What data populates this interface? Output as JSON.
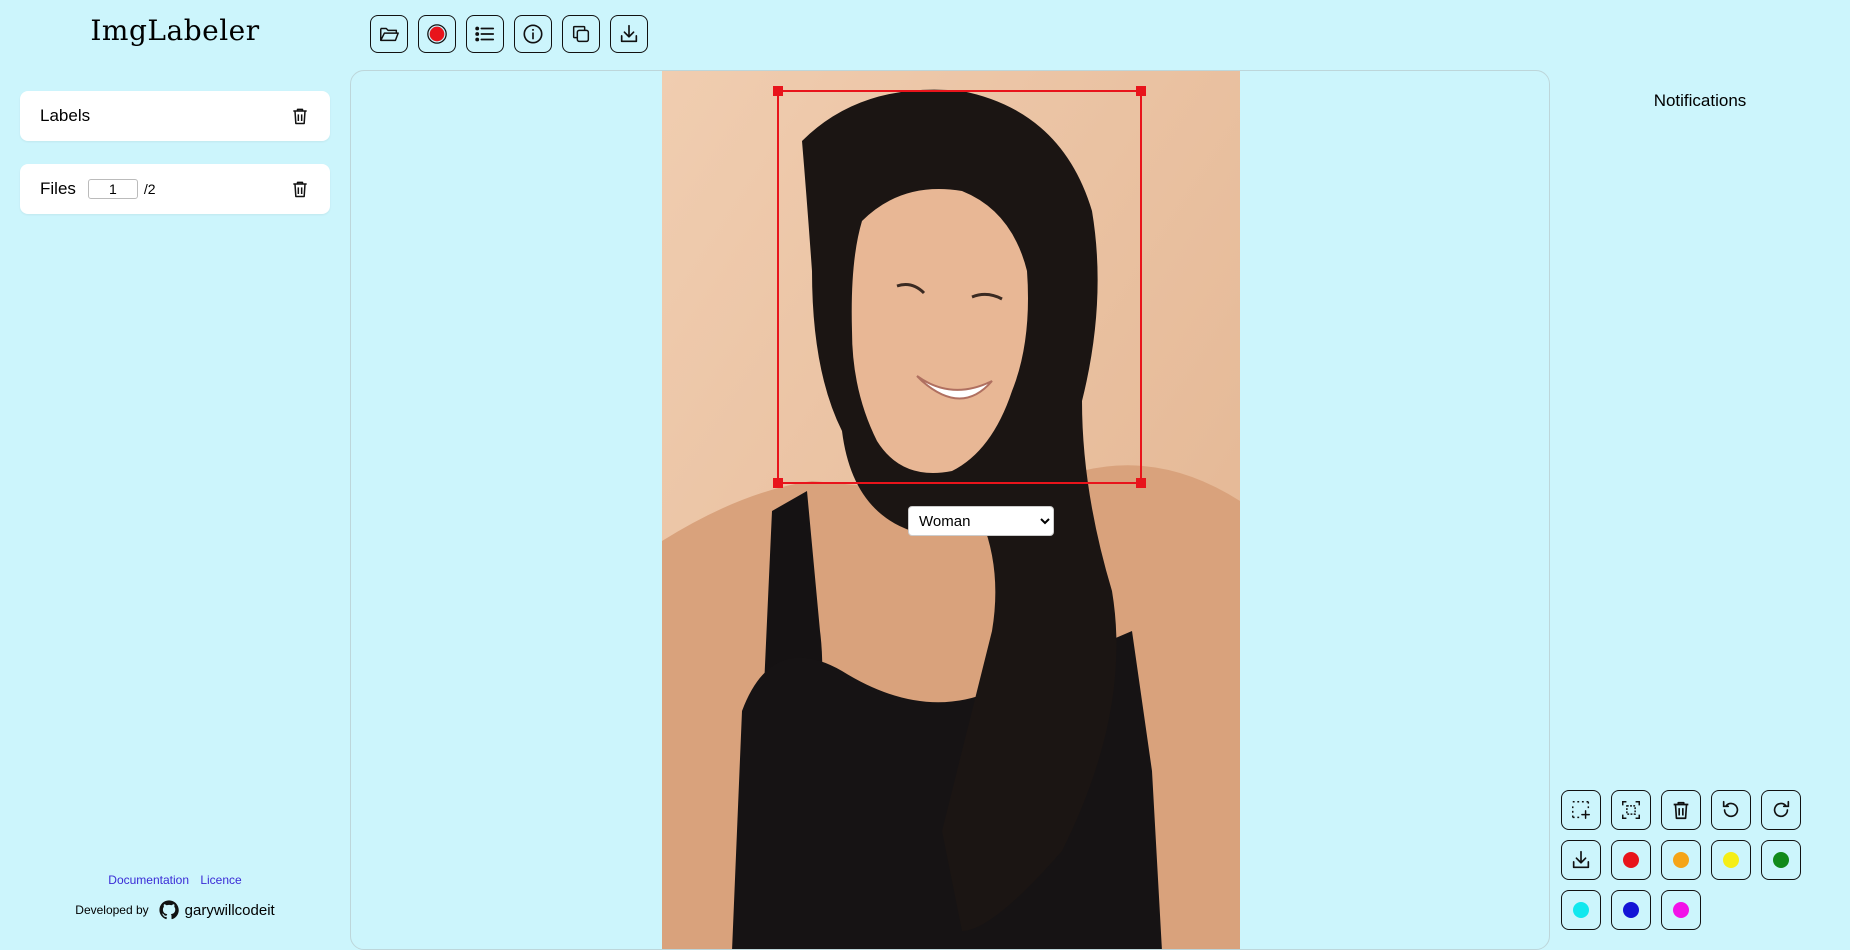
{
  "app": {
    "title": "ImgLabeler"
  },
  "toolbar": {
    "buttons": [
      {
        "name": "open-folder-button",
        "icon": "folder-open-icon"
      },
      {
        "name": "record-button",
        "icon": "record-icon"
      },
      {
        "name": "list-button",
        "icon": "list-icon"
      },
      {
        "name": "info-button",
        "icon": "info-icon"
      },
      {
        "name": "copy-button",
        "icon": "copy-icon"
      },
      {
        "name": "download-button",
        "icon": "download-icon"
      }
    ]
  },
  "sidebar": {
    "labels_title": "Labels",
    "files_title": "Files",
    "files_current": "1",
    "files_total": "/2"
  },
  "footer": {
    "documentation": "Documentation",
    "licence": "Licence",
    "developed_by": "Developed by",
    "github_user": "garywillcodeit"
  },
  "canvas": {
    "annotation": {
      "label": "Woman",
      "color": "#e8141b"
    }
  },
  "notifications": {
    "title": "Notifications"
  },
  "tools": {
    "actions": [
      {
        "name": "add-box-button",
        "icon": "add-box-icon"
      },
      {
        "name": "select-all-button",
        "icon": "focus-box-icon"
      },
      {
        "name": "delete-box-button",
        "icon": "trash-icon"
      },
      {
        "name": "undo-button",
        "icon": "undo-icon"
      },
      {
        "name": "redo-button",
        "icon": "redo-icon"
      },
      {
        "name": "export-button",
        "icon": "download-icon"
      }
    ],
    "colors": [
      "#e8141b",
      "#f5a418",
      "#f5ee18",
      "#128a1a",
      "#12e8ee",
      "#1414d6",
      "#f212e8"
    ]
  }
}
